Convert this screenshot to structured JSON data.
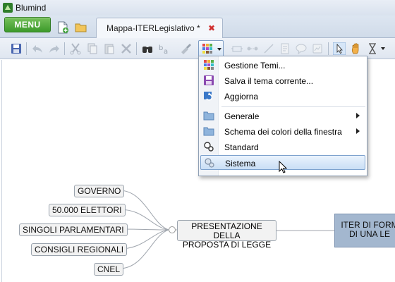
{
  "window": {
    "title": "Blumind"
  },
  "tabbar": {
    "menu_label": "MENU",
    "document_tab": "Mappa-ITERLegislativo *",
    "close_symbol": "✖"
  },
  "theme_menu": {
    "items": [
      {
        "label": "Gestione Temi...",
        "icon": "palette-grid-icon",
        "submenu": false
      },
      {
        "label": "Salva il tema corrente...",
        "icon": "save-disk-icon",
        "submenu": false
      },
      {
        "label": "Aggiorna",
        "icon": "refresh-icon",
        "submenu": false
      },
      {
        "label": "Generale",
        "icon": "folder-icon",
        "submenu": true
      },
      {
        "label": "Schema dei colori della finestra",
        "icon": "folder-icon",
        "submenu": true
      },
      {
        "label": "Standard",
        "icon": "theme-circles-icon",
        "submenu": false
      },
      {
        "label": "Sistema",
        "icon": "theme-circles-icon",
        "submenu": false,
        "selected": true
      }
    ]
  },
  "mindmap": {
    "root": "ITER DI FORMAZIONE DI UNA LEGGE",
    "root_line1": "ITER DI FORM",
    "root_line2": "DI UNA LE",
    "center_line1": "PRESENTAZIONE DELLA",
    "center_line2": "PROPOSTA DI LEGGE",
    "branches": [
      "GOVERNO",
      "50.000 ELETTORI",
      "SINGOLI PARLAMENTARI",
      "CONSIGLI REGIONALI",
      "CNEL"
    ]
  },
  "colors": {
    "menu_button": "#3c9a2a",
    "root_node": "#a3b7cf",
    "tab_close": "#d03030"
  }
}
